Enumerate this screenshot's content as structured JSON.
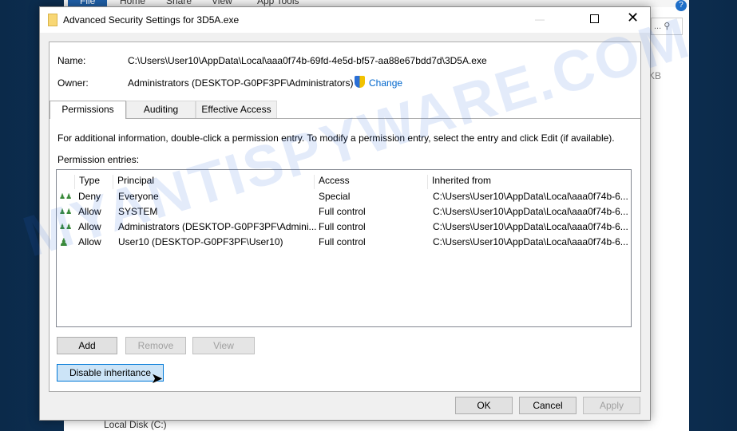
{
  "explorer": {
    "tabs": [
      "File",
      "Home",
      "Share",
      "View",
      "App Tools"
    ],
    "search_hint": "...",
    "size_col": "KB",
    "nav_item": "Local Disk (C:)"
  },
  "dialog": {
    "title": "Advanced Security Settings for 3D5A.exe",
    "name_label": "Name:",
    "name_value": "C:\\Users\\User10\\AppData\\Local\\aaa0f74b-69fd-4e5d-bf57-aa88e67bdd7d\\3D5A.exe",
    "owner_label": "Owner:",
    "owner_value": "Administrators (DESKTOP-G0PF3PF\\Administrators)",
    "change_link": "Change",
    "tabs": [
      "Permissions",
      "Auditing",
      "Effective Access"
    ],
    "info": "For additional information, double-click a permission entry. To modify a permission entry, select the entry and click Edit (if available).",
    "entries_label": "Permission entries:",
    "columns": [
      "Type",
      "Principal",
      "Access",
      "Inherited from"
    ],
    "rows": [
      {
        "icon": "group",
        "type": "Deny",
        "principal": "Everyone",
        "access": "Special",
        "inherited": "C:\\Users\\User10\\AppData\\Local\\aaa0f74b-6..."
      },
      {
        "icon": "group",
        "type": "Allow",
        "principal": "SYSTEM",
        "access": "Full control",
        "inherited": "C:\\Users\\User10\\AppData\\Local\\aaa0f74b-6..."
      },
      {
        "icon": "group",
        "type": "Allow",
        "principal": "Administrators (DESKTOP-G0PF3PF\\Admini...",
        "access": "Full control",
        "inherited": "C:\\Users\\User10\\AppData\\Local\\aaa0f74b-6..."
      },
      {
        "icon": "user",
        "type": "Allow",
        "principal": "User10 (DESKTOP-G0PF3PF\\User10)",
        "access": "Full control",
        "inherited": "C:\\Users\\User10\\AppData\\Local\\aaa0f74b-6..."
      }
    ],
    "add": "Add",
    "remove": "Remove",
    "view": "View",
    "disable_inheritance": "Disable inheritance",
    "ok": "OK",
    "cancel": "Cancel",
    "apply": "Apply"
  },
  "watermark": "MYANTISPYWARE.COM"
}
